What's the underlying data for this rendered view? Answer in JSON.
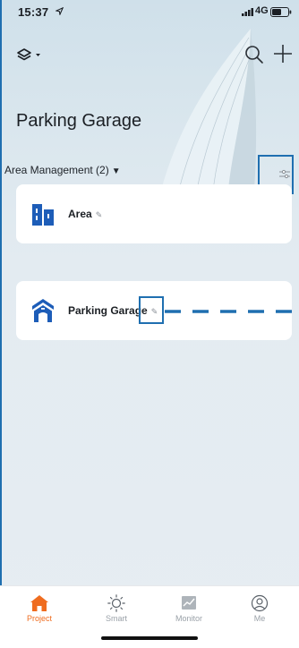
{
  "status_bar": {
    "time": "15:37",
    "network": "4G"
  },
  "header": {
    "title": "Parking Garage"
  },
  "section": {
    "label": "Area Management (2)",
    "caret": "▼"
  },
  "items": [
    {
      "label": "Area",
      "icon": "area-building-icon"
    },
    {
      "label": "Parking Garage",
      "icon": "parking-garage-icon"
    }
  ],
  "tabs": [
    {
      "label": "Project",
      "active": true,
      "icon": "home-icon"
    },
    {
      "label": "Smart",
      "active": false,
      "icon": "sun-icon"
    },
    {
      "label": "Monitor",
      "active": false,
      "icon": "chart-icon"
    },
    {
      "label": "Me",
      "active": false,
      "icon": "user-icon"
    }
  ],
  "colors": {
    "accent": "#ef6c1f",
    "brand_blue": "#1d5db8",
    "highlight": "#1f6fb0"
  }
}
